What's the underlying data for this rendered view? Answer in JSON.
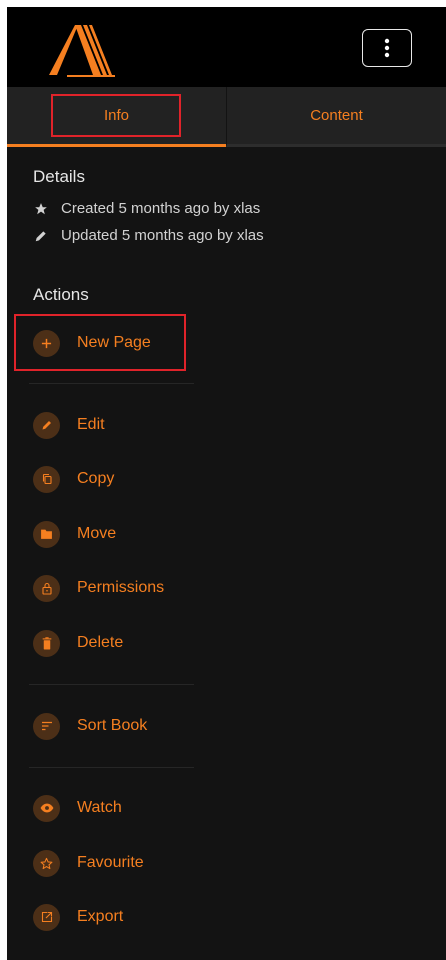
{
  "tabs": {
    "info_label": "Info",
    "content_label": "Content"
  },
  "details": {
    "title": "Details",
    "created": "Created 5 months ago by xlas",
    "updated": "Updated 5 months ago by xlas"
  },
  "actions": {
    "title": "Actions",
    "new_page": "New Page",
    "edit": "Edit",
    "copy": "Copy",
    "move": "Move",
    "permissions": "Permissions",
    "delete": "Delete",
    "sort_book": "Sort Book",
    "watch": "Watch",
    "favourite": "Favourite",
    "export": "Export"
  },
  "icons": {
    "logo": "bookstack-logo",
    "menu": "vertical-dots-icon",
    "star": "star-icon",
    "pencil": "pencil-icon",
    "plus": "plus-icon",
    "copy": "copy-icon",
    "folder": "folder-icon",
    "lock": "lock-icon",
    "trash": "trash-icon",
    "sort": "sort-icon",
    "eye": "eye-icon",
    "star_outline": "star-outline-icon",
    "export": "export-icon"
  },
  "colors": {
    "accent": "#f57f20",
    "background": "#131313",
    "topbar": "#000000",
    "highlight": "#e0232a"
  }
}
